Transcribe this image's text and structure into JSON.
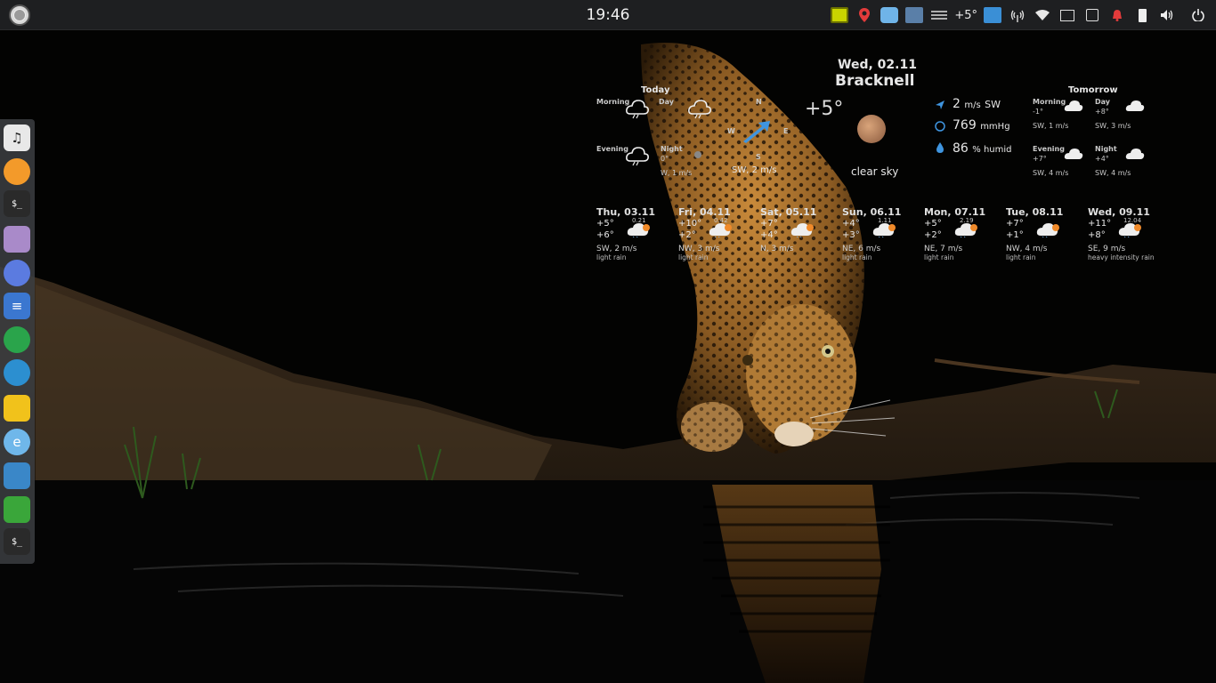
{
  "panel": {
    "clock": "19:46",
    "tray_temp": "+5°",
    "icons": [
      "monitor-icon",
      "location-pin-icon",
      "app-icon",
      "music-visualizer-icon",
      "equalizer-icon",
      "translate-icon",
      "wireless-icon",
      "wifi-icon",
      "window-icon",
      "printer-icon",
      "notification-icon",
      "battery-icon",
      "volume-icon",
      "power-icon"
    ]
  },
  "dock": {
    "items": [
      "music-player",
      "firefox",
      "terminal",
      "files",
      "browser",
      "text-editor",
      "chrome",
      "synaptic",
      "game",
      "edge",
      "system-monitor",
      "keys",
      "terminal"
    ]
  },
  "weather": {
    "date": "Wed, 02.11",
    "city": "Bracknell",
    "today": {
      "label": "Today",
      "morning_label": "Morning",
      "day_label": "Day",
      "evening_label": "Evening",
      "night_label": "Night",
      "night_temp": "0°",
      "night_wind": "W, 1 m/s"
    },
    "compass": {
      "n": "N",
      "w": "W",
      "e": "E",
      "s": "S"
    },
    "current": {
      "temp": "+5°",
      "wind_summary": "SW, 2 m/s",
      "condition": "clear sky"
    },
    "details": {
      "wind_value": "2",
      "wind_unit": "m/s",
      "wind_dir": "SW",
      "pressure_value": "769",
      "pressure_unit": "mmHg",
      "humidity_value": "86",
      "humidity_unit": "% humid"
    },
    "tomorrow": {
      "label": "Tomorrow",
      "morning_label": "Morning",
      "morning_temp": "-1°",
      "morning_wind": "SW, 1 m/s",
      "day_label": "Day",
      "day_temp": "+8°",
      "day_wind": "SW, 3 m/s",
      "evening_label": "Evening",
      "evening_temp": "+7°",
      "evening_wind": "SW, 4 m/s",
      "night_label": "Night",
      "night_temp": "+4°",
      "night_wind": "SW, 4 m/s"
    },
    "forecast": [
      {
        "date": "Thu, 03.11",
        "hi": "+5°",
        "lo": "+6°",
        "precip": "0.21",
        "wind": "SW, 2 m/s",
        "desc": "light rain"
      },
      {
        "date": "Fri, 04.11",
        "hi": "+10°",
        "lo": "+2°",
        "precip": "0.42",
        "wind": "NW, 3 m/s",
        "desc": "light rain"
      },
      {
        "date": "Sat, 05.11",
        "hi": "+7°",
        "lo": "+4°",
        "precip": "",
        "wind": "N, 3 m/s",
        "desc": ""
      },
      {
        "date": "Sun, 06.11",
        "hi": "+4°",
        "lo": "+3°",
        "precip": "1.11",
        "wind": "NE, 6 m/s",
        "desc": "light rain"
      },
      {
        "date": "Mon, 07.11",
        "hi": "+5°",
        "lo": "+2°",
        "precip": "2.19",
        "wind": "NE, 7 m/s",
        "desc": "light rain"
      },
      {
        "date": "Tue, 08.11",
        "hi": "+7°",
        "lo": "+1°",
        "precip": "",
        "wind": "NW, 4 m/s",
        "desc": "light rain"
      },
      {
        "date": "Wed, 09.11",
        "hi": "+11°",
        "lo": "+8°",
        "precip": "12.04",
        "wind": "SE, 9 m/s",
        "desc": "heavy intensity rain"
      }
    ]
  }
}
